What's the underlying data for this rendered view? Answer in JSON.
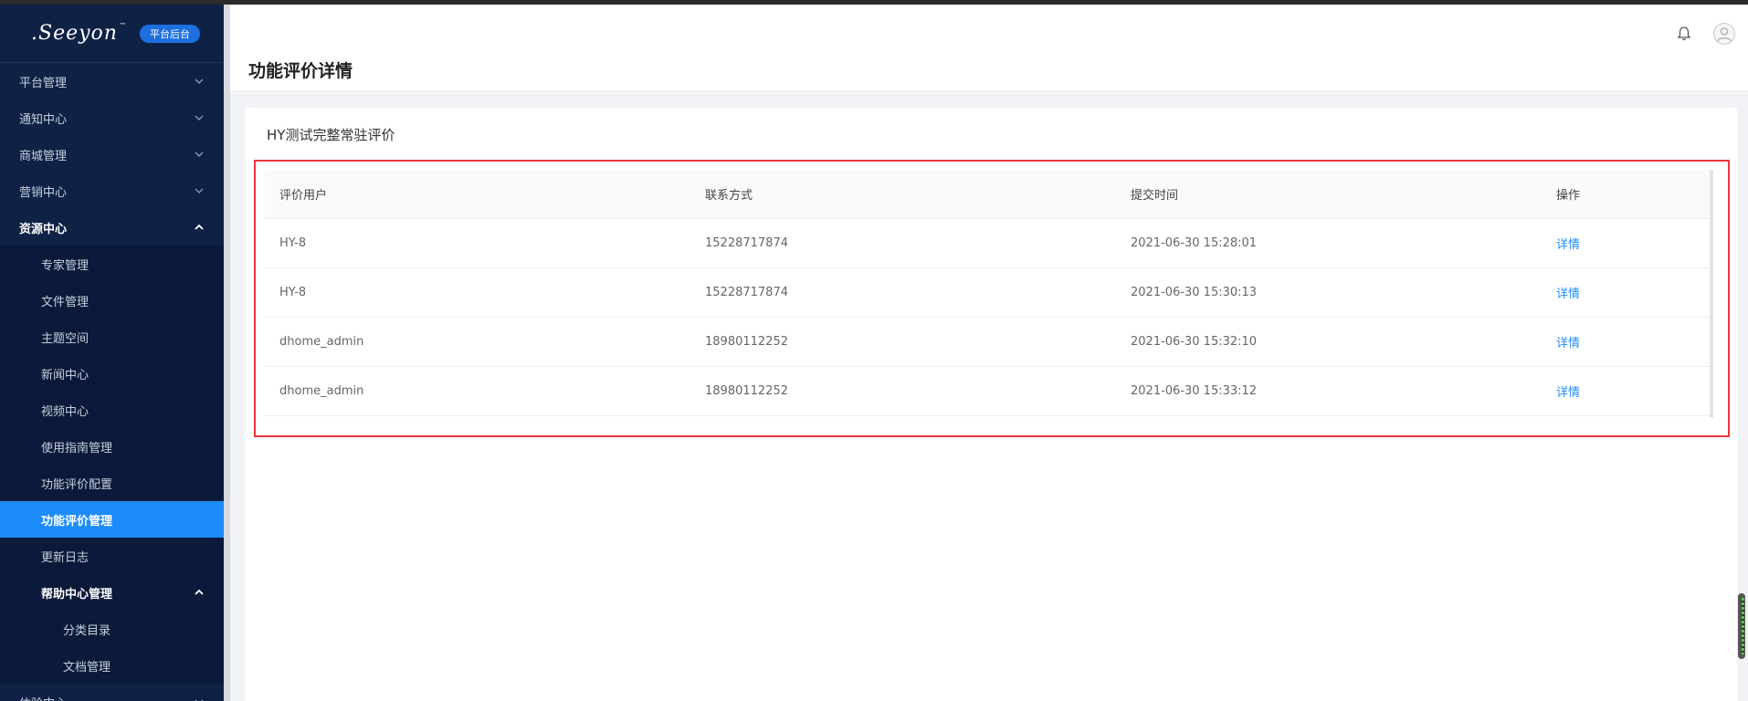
{
  "app": {
    "logo_text": ".Seeyon",
    "logo_tm": "™",
    "badge": "平台后台"
  },
  "sidebar": {
    "top_items": [
      {
        "label": "平台管理",
        "icon": "chevron-down-icon"
      },
      {
        "label": "通知中心",
        "icon": "chevron-down-icon"
      },
      {
        "label": "商城管理",
        "icon": "chevron-down-icon"
      },
      {
        "label": "营销中心",
        "icon": "chevron-down-icon"
      }
    ],
    "open_item": {
      "label": "资源中心",
      "icon": "chevron-up-icon"
    },
    "sub_items": [
      {
        "label": "专家管理"
      },
      {
        "label": "文件管理"
      },
      {
        "label": "主题空间"
      },
      {
        "label": "新闻中心"
      },
      {
        "label": "视频中心"
      },
      {
        "label": "使用指南管理"
      },
      {
        "label": "功能评价配置"
      },
      {
        "label": "功能评价管理",
        "active": true
      },
      {
        "label": "更新日志"
      }
    ],
    "group_item": {
      "label": "帮助中心管理",
      "icon": "chevron-up-icon"
    },
    "group_children": [
      {
        "label": "分类目录"
      },
      {
        "label": "文档管理"
      }
    ],
    "partial_item": {
      "label": "体验中心"
    }
  },
  "header": {
    "title": "功能评价详情",
    "icons": [
      "bell-icon",
      "user-avatar-icon"
    ]
  },
  "card": {
    "title": "HY测试完整常驻评价",
    "columns": [
      "评价用户",
      "联系方式",
      "提交时间",
      "操作"
    ],
    "rows": [
      {
        "user": "HY-8",
        "contact": "15228717874",
        "time": "2021-06-30 15:28:01",
        "action": "详情"
      },
      {
        "user": "HY-8",
        "contact": "15228717874",
        "time": "2021-06-30 15:30:13",
        "action": "详情"
      },
      {
        "user": "dhome_admin",
        "contact": "18980112252",
        "time": "2021-06-30 15:32:10",
        "action": "详情"
      },
      {
        "user": "dhome_admin",
        "contact": "18980112252",
        "time": "2021-06-30 15:33:12",
        "action": "详情"
      }
    ]
  },
  "colors": {
    "sidebar_bg": "#0f2246",
    "active_item": "#1d8cf8",
    "highlight_border": "#e8373b",
    "link": "#1d8cf8"
  }
}
